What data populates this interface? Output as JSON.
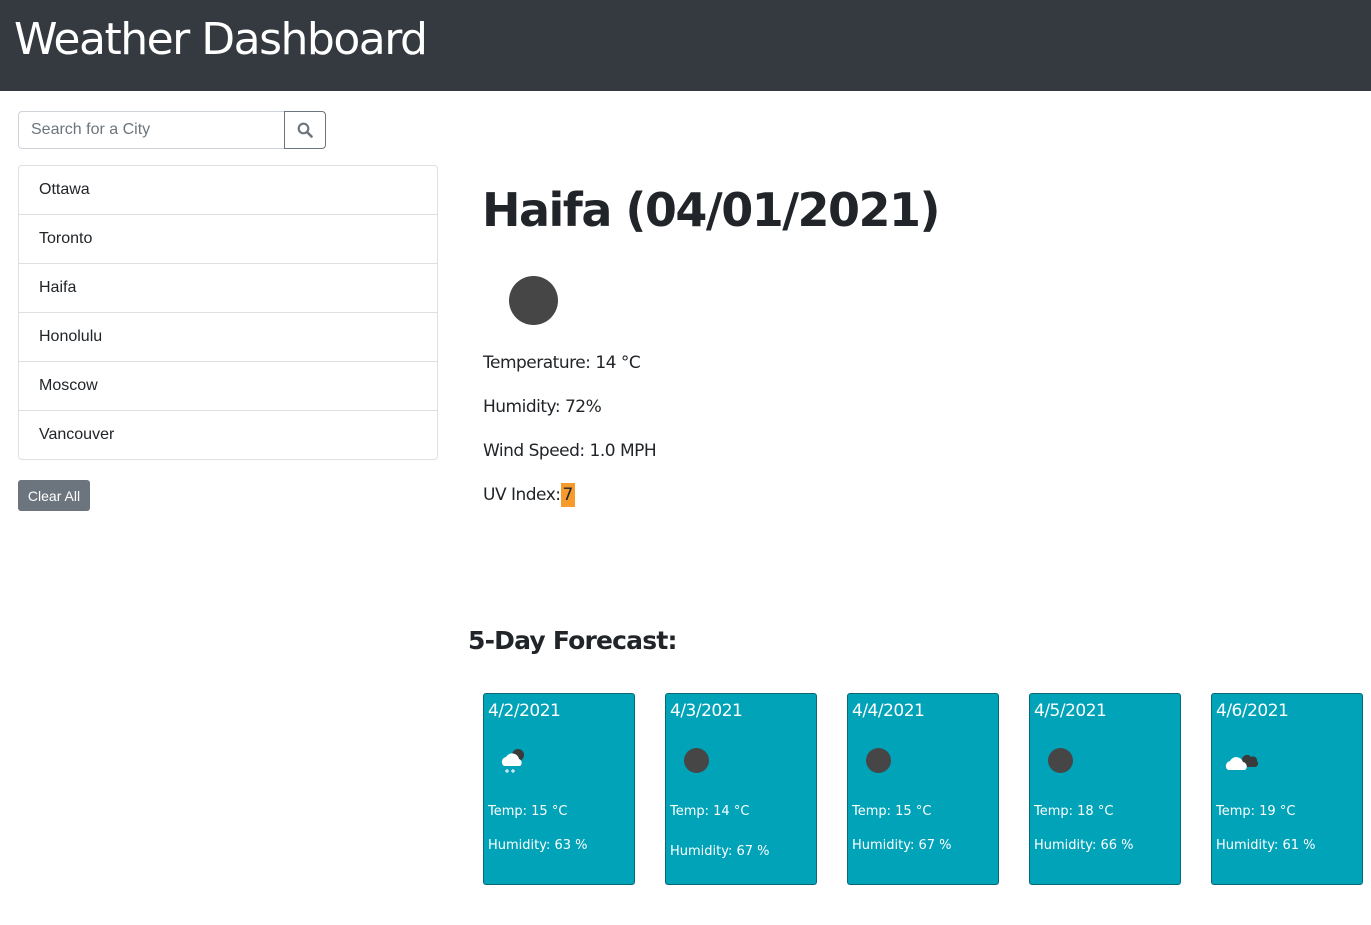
{
  "header": {
    "title": "Weather Dashboard"
  },
  "search": {
    "placeholder": "Search for a City",
    "value": "",
    "button_icon": "search-icon"
  },
  "history": {
    "cities": [
      "Ottawa",
      "Toronto",
      "Haifa",
      "Honolulu",
      "Moscow",
      "Vancouver"
    ]
  },
  "clear_label": "Clear All",
  "current": {
    "heading": "Haifa (04/01/2021)",
    "icon": "dark-circle-icon",
    "temperature": "Temperature: 14 °C",
    "humidity": "Humidity: 72%",
    "wind": "Wind Speed: 1.0 MPH",
    "uv_label": "UV Index:",
    "uv_value": "7",
    "uv_color": "#f79a2c"
  },
  "forecast": {
    "heading": "5-Day Forecast:",
    "card_color": "#00a3b8",
    "days": [
      {
        "date": "4/2/2021",
        "icon": "snow-cloud-icon",
        "temp": "Temp: 15 °C",
        "humidity": "Humidity: 63 %"
      },
      {
        "date": "4/3/2021",
        "icon": "dark-circle-icon",
        "temp": "Temp: 14 °C",
        "humidity": "Humidity: 67 %"
      },
      {
        "date": "4/4/2021",
        "icon": "dark-circle-icon",
        "temp": "Temp: 15 °C",
        "humidity": "Humidity: 67 %"
      },
      {
        "date": "4/5/2021",
        "icon": "dark-circle-icon",
        "temp": "Temp: 18 °C",
        "humidity": "Humidity: 66 %"
      },
      {
        "date": "4/6/2021",
        "icon": "cloudy-icon",
        "temp": "Temp: 19 °C",
        "humidity": "Humidity: 61 %"
      }
    ]
  }
}
